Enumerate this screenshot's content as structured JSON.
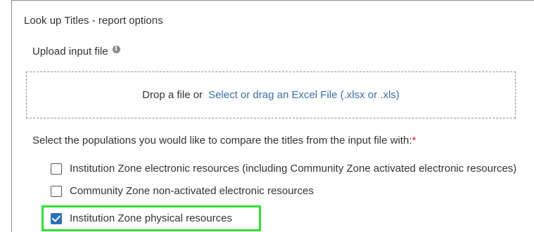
{
  "panel": {
    "title": "Look up Titles - report options"
  },
  "upload": {
    "label": "Upload input file",
    "info_icon": "info-icon",
    "dropzone": {
      "prefix": "Drop a file or",
      "link": "Select or drag an Excel File (.xlsx or .xls)"
    }
  },
  "populations": {
    "question": "Select the populations you would like to compare the titles from the input file with:",
    "required_marker": "*",
    "options": [
      {
        "label": "Institution Zone electronic resources (including Community Zone activated electronic resources)",
        "checked": false
      },
      {
        "label": "Community Zone non-activated electronic resources",
        "checked": false
      },
      {
        "label": "Institution Zone physical resources",
        "checked": true
      }
    ]
  },
  "colors": {
    "link": "#3b6ea5",
    "checkbox_checked": "#2b6fb6",
    "required": "#e02020",
    "highlight": "#33e033"
  }
}
